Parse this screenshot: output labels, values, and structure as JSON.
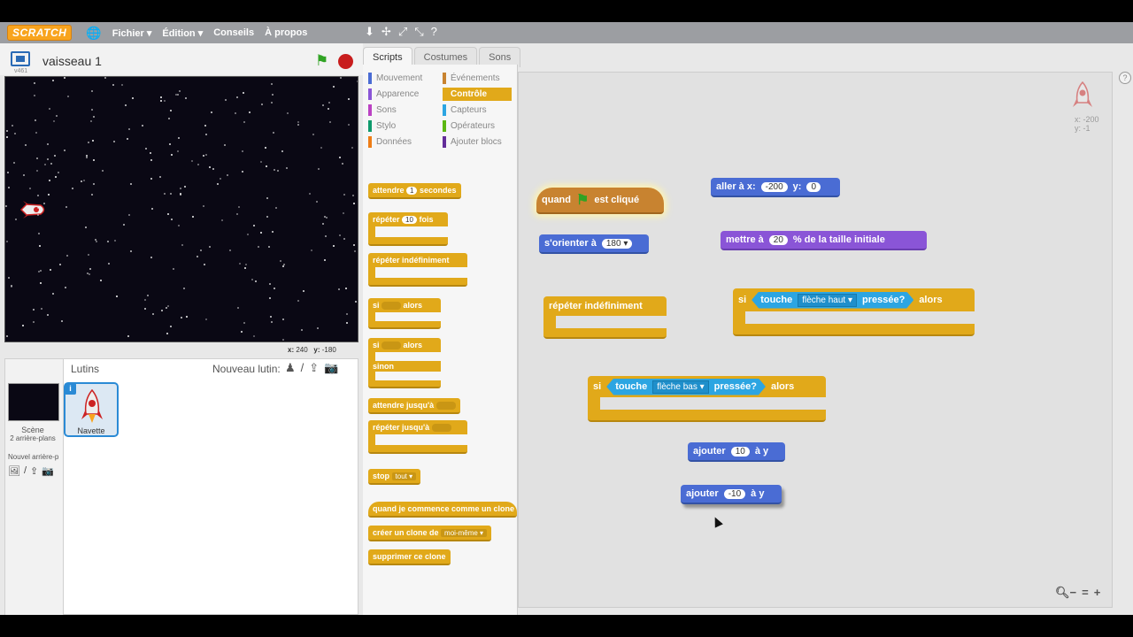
{
  "menubar": {
    "logo": "SCRATCH",
    "items": [
      "Fichier ▾",
      "Édition ▾",
      "Conseils",
      "À propos"
    ]
  },
  "stage": {
    "sprite_name": "vaisseau 1",
    "version": "v461",
    "mouse_x_label": "x:",
    "mouse_x": "240",
    "mouse_y_label": "y:",
    "mouse_y": "-180"
  },
  "sprites": {
    "title": "Lutins",
    "new_sprite_label": "Nouveau lutin:",
    "scene_label": "Scène",
    "scene_sub": "2 arrière-plans",
    "new_bg_label": "Nouvel arrière-p",
    "sprite_name": "Navette"
  },
  "tabs": [
    "Scripts",
    "Costumes",
    "Sons"
  ],
  "categories": [
    {
      "label": "Mouvement",
      "color": "#4a6cd4"
    },
    {
      "label": "Événements",
      "color": "#c88330"
    },
    {
      "label": "Apparence",
      "color": "#8a55d7"
    },
    {
      "label": "Contrôle",
      "color": "#e1a91a"
    },
    {
      "label": "Sons",
      "color": "#bb42c3"
    },
    {
      "label": "Capteurs",
      "color": "#2ca5e2"
    },
    {
      "label": "Stylo",
      "color": "#0e9a6c"
    },
    {
      "label": "Opérateurs",
      "color": "#5cb712"
    },
    {
      "label": "Données",
      "color": "#ee7d16"
    },
    {
      "label": "Ajouter blocs",
      "color": "#632d99"
    }
  ],
  "palette": {
    "wait_pre": "attendre",
    "wait_val": "1",
    "wait_post": "secondes",
    "repeat_pre": "répéter",
    "repeat_val": "10",
    "repeat_post": "fois",
    "forever": "répéter indéfiniment",
    "if": "si",
    "then": "alors",
    "else": "sinon",
    "wait_until": "attendre jusqu'à",
    "repeat_until": "répéter jusqu'à",
    "stop": "stop",
    "stop_opt": "tout ▾",
    "when_clone": "quand je commence comme un clone",
    "create_clone": "créer un clone de",
    "create_clone_opt": "moi-même ▾",
    "delete_clone": "supprimer ce clone"
  },
  "scripts": {
    "hat_when": "quand",
    "hat_clicked": "est cliqué",
    "point_label": "s'orienter à",
    "point_val": "180 ▾",
    "goto_label": "aller à x:",
    "goto_x": "-200",
    "goto_y_label": "y:",
    "goto_y": "0",
    "size_label": "mettre à",
    "size_val": "20",
    "size_post": "% de la taille initiale",
    "forever": "répéter indéfiniment",
    "if1": "si",
    "if1_touch": "touche",
    "if1_key": "flèche haut ▾",
    "if1_pressed": "pressée?",
    "if1_then": "alors",
    "if2": "si",
    "if2_touch": "touche",
    "if2_key": "flèche bas ▾",
    "if2_pressed": "pressée?",
    "if2_then": "alors",
    "change1_label": "ajouter",
    "change1_val": "10",
    "change1_post": "à y",
    "change2_label": "ajouter",
    "change2_val": "-10",
    "change2_post": "à y",
    "ghost_x": "x: -200",
    "ghost_y": "y: -1"
  }
}
